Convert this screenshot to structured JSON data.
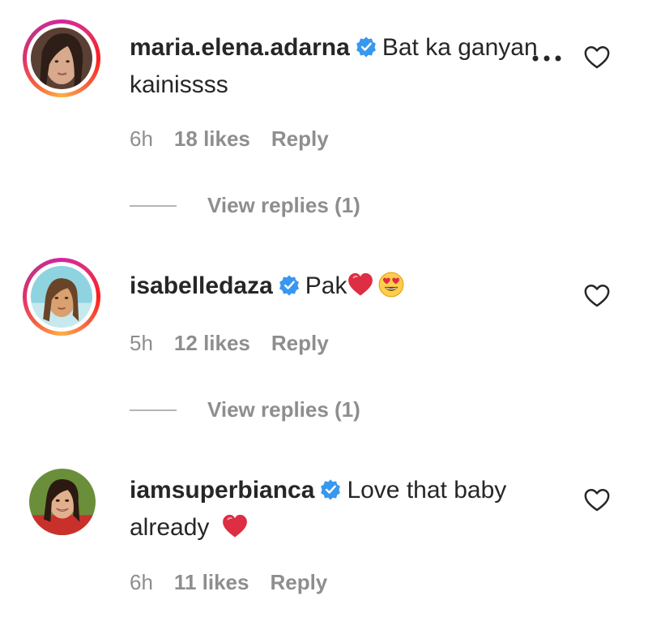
{
  "comments": [
    {
      "username": "maria.elena.adarna",
      "text": "Bat ka ganyan kainissss",
      "time": "6h",
      "likes": "18 likes",
      "reply": "Reply",
      "view_replies": "View replies (1)"
    },
    {
      "username": "isabelledaza",
      "text": "Pak",
      "time": "5h",
      "likes": "12 likes",
      "reply": "Reply",
      "view_replies": "View replies (1)"
    },
    {
      "username": "iamsuperbianca",
      "text": "Love that baby already",
      "time": "6h",
      "likes": "11 likes",
      "reply": "Reply"
    }
  ],
  "icons": {
    "verified": "verified-badge-icon",
    "like": "heart-outline-icon",
    "more": "more-options-icon",
    "red_heart": "red-heart-emoji",
    "heart_eyes": "heart-eyes-emoji"
  },
  "colors": {
    "verified_blue": "#3897f0",
    "meta_gray": "#8e8e8e",
    "text": "#262626",
    "heart_red": "#e0245e"
  }
}
